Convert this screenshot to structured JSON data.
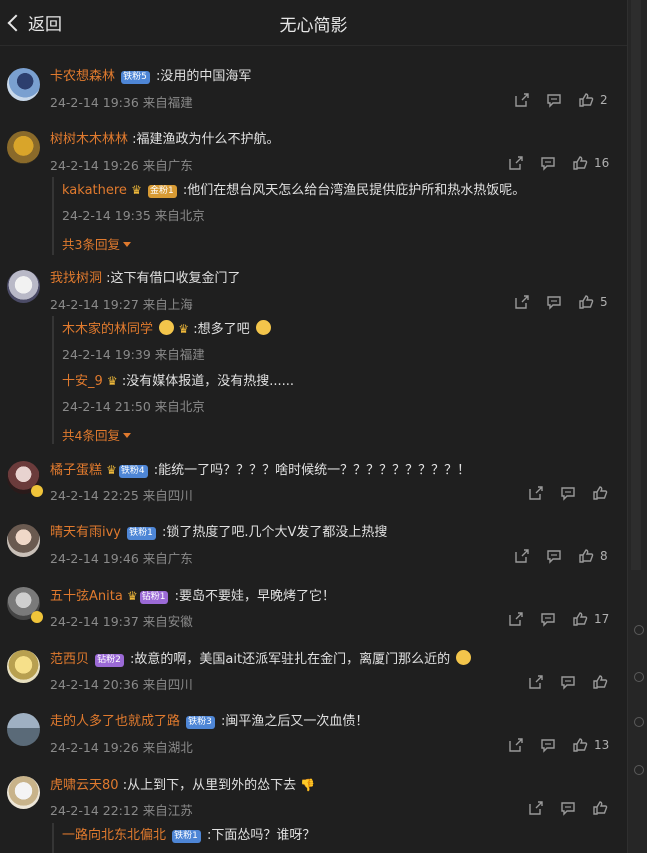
{
  "header": {
    "back_label": "返回",
    "title": "无心简影"
  },
  "comments": [
    {
      "user": "卡农想森林",
      "badge": "铁粉5",
      "text": ":没用的中国海军",
      "time": "24-2-14 19:36",
      "loc": "来自福建",
      "likes": "2"
    },
    {
      "user": "树树木木林林",
      "text": ":福建渔政为什么不护航。",
      "time": "24-2-14 19:26",
      "loc": "来自广东",
      "likes": "16",
      "replies": [
        {
          "user": "kakathere",
          "badge": "金粉1",
          "text": ":他们在想台风天怎么给台湾渔民提供庇护所和热水热饭呢。",
          "time": "24-2-14 19:35",
          "loc": "来自北京"
        }
      ],
      "more": "共3条回复"
    },
    {
      "user": "我找树洞",
      "text": ":这下有借口收复金门了",
      "time": "24-2-14 19:27",
      "loc": "来自上海",
      "likes": "5",
      "replies": [
        {
          "user": "木木家的林同学",
          "text": ":想多了吧",
          "time": "24-2-14 19:39",
          "loc": "来自福建"
        },
        {
          "user": "十安_9",
          "text": ":没有媒体报道，没有热搜......",
          "time": "24-2-14 21:50",
          "loc": "来自北京"
        }
      ],
      "more": "共4条回复"
    },
    {
      "user": "橘子蛋糕",
      "badge": "铁粉4",
      "text": ":能统一了吗？？？？啥时候统一？？？？？？？？？！",
      "time": "24-2-14 22:25",
      "loc": "来自四川",
      "likes": ""
    },
    {
      "user": "晴天有雨ivy",
      "badge": "铁粉1",
      "text": ":锁了热度了吧.几个大V发了都没上热搜",
      "time": "24-2-14 19:46",
      "loc": "来自广东",
      "likes": "8"
    },
    {
      "user": "五十弦Anita",
      "badge": "钻粉1",
      "text": ":要岛不要娃，早晚烤了它！",
      "time": "24-2-14 19:37",
      "loc": "来自安徽",
      "likes": "17"
    },
    {
      "user": "范西贝",
      "badge": "钻粉2",
      "text": ":故意的啊，美国ait还派军驻扎在金门，离厦门那么近的",
      "time": "24-2-14 20:36",
      "loc": "来自四川",
      "likes": ""
    },
    {
      "user": "走的人多了也就成了路",
      "badge": "铁粉3",
      "text": ":闽平渔之后又一次血债！",
      "time": "24-2-14 19:26",
      "loc": "来自湖北",
      "likes": "13"
    },
    {
      "user": "虎啸云天80",
      "text": ":从上到下，从里到外的怂下去",
      "time": "24-2-14 22:12",
      "loc": "来自江苏",
      "likes": "",
      "replies": [
        {
          "user": "一路向北东北偏北",
          "badge": "铁粉1",
          "text": ":下面怂吗？谁呀？"
        }
      ]
    }
  ],
  "colors": {
    "username": "#e07a2e",
    "background": "#1f1f1f",
    "meta": "#8a8a8a"
  },
  "icons": [
    "back-chevron-icon",
    "share-icon",
    "comment-icon",
    "like-icon",
    "crown-icon",
    "emoji-icon"
  ]
}
